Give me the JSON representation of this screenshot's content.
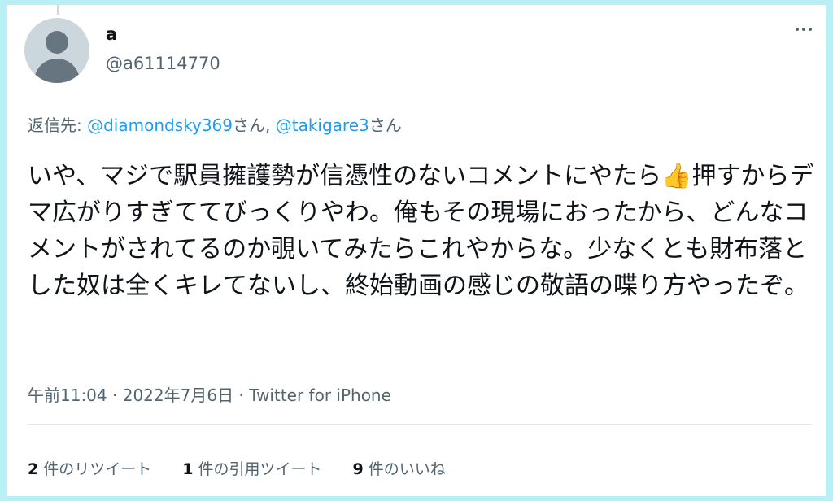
{
  "user": {
    "display_name": "a",
    "handle": "@a61114770"
  },
  "reply": {
    "prefix": "返信先: ",
    "mention1": "@diamondsky369",
    "suffix1": "さん, ",
    "mention2": "@takigare3",
    "suffix2": "さん"
  },
  "tweet": {
    "part1": "いや、マジで駅員擁護勢が信憑性のないコメントにやたら",
    "emoji": "👍",
    "part2": "押すからデマ広がりすぎててびっくりやわ。俺もその現場におったから、どんなコメントがされてるのか覗いてみたらこれやからな。少なくとも財布落とした奴は全くキレてないし、終始動画の感じの敬語の喋り方やったぞ。"
  },
  "meta": {
    "time": "午前11:04",
    "sep1": " · ",
    "date": "2022年7月6日",
    "sep2": " · ",
    "source": "Twitter for iPhone"
  },
  "stats": {
    "retweets_count": "2",
    "retweets_label": "件のリツイート",
    "quotes_count": "1",
    "quotes_label": "件の引用ツイート",
    "likes_count": "9",
    "likes_label": "件のいいね"
  },
  "icons": {
    "avatar": "default-profile-avatar",
    "more": "more-horizontal-icon",
    "emoji": "thumbs-up-emoji"
  },
  "colors": {
    "background": "#b8f0f5",
    "link": "#1d9bf0",
    "secondary_text": "#536471",
    "primary_text": "#0f1419"
  }
}
